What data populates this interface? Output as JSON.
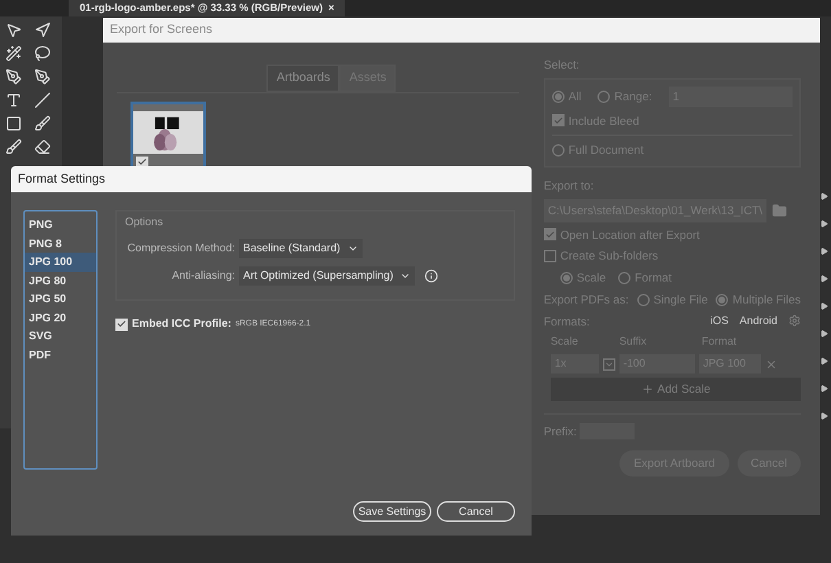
{
  "document_tab": {
    "title": "01-rgb-logo-amber.eps* @ 33.33 % (RGB/Preview)",
    "close": "×"
  },
  "export_dialog": {
    "title": "Export for Screens",
    "tabs": [
      {
        "label": "Artboards",
        "selected": true
      },
      {
        "label": "Assets",
        "selected": false
      }
    ],
    "artboard": {
      "checked": true
    },
    "select": {
      "label": "Select:",
      "options": [
        {
          "label": "All",
          "selected": true
        },
        {
          "label": "Range:",
          "selected": false
        }
      ],
      "range_value": "1",
      "include_bleed": {
        "label": "Include Bleed",
        "checked": true
      },
      "full_document": {
        "label": "Full Document",
        "selected": false
      }
    },
    "export_to": {
      "label": "Export to:",
      "path": "C:\\Users\\stefa\\Desktop\\01_Werk\\13_ICT\\",
      "open_location": {
        "label": "Open Location after Export",
        "checked": true
      },
      "sub_folders": {
        "label": "Create Sub-folders",
        "checked": false
      },
      "sub_options": [
        {
          "label": "Scale",
          "selected": true
        },
        {
          "label": "Format",
          "selected": false
        }
      ]
    },
    "export_pdfs": {
      "label": "Export PDFs as:",
      "options": [
        {
          "label": "Single File",
          "selected": false
        },
        {
          "label": "Multiple Files",
          "selected": true
        }
      ]
    },
    "formats": {
      "label": "Formats:",
      "presets": [
        "iOS",
        "Android"
      ],
      "columns": [
        "Scale",
        "Suffix",
        "Format"
      ],
      "rows": [
        {
          "scale": "1x",
          "suffix": "-100",
          "format": "JPG 100"
        }
      ],
      "add_scale": "Add Scale"
    },
    "prefix": {
      "label": "Prefix:"
    },
    "buttons": [
      "Export Artboard",
      "Cancel"
    ]
  },
  "format_settings": {
    "title": "Format Settings",
    "formats": [
      {
        "label": "PNG",
        "selected": false
      },
      {
        "label": "PNG 8",
        "selected": false
      },
      {
        "label": "JPG 100",
        "selected": true
      },
      {
        "label": "JPG 80",
        "selected": false
      },
      {
        "label": "JPG 50",
        "selected": false
      },
      {
        "label": "JPG 20",
        "selected": false
      },
      {
        "label": "SVG",
        "selected": false
      },
      {
        "label": "PDF",
        "selected": false
      }
    ],
    "options_title": "Options",
    "compression": {
      "label": "Compression Method:",
      "value": "Baseline (Standard)"
    },
    "anti_aliasing": {
      "label": "Anti-aliasing:",
      "value": "Art Optimized (Supersampling)"
    },
    "embed_icc": {
      "label": "Embed ICC Profile:",
      "value": "sRGB IEC61966-2.1",
      "checked": true
    },
    "buttons": [
      "Save Settings",
      "Cancel"
    ]
  }
}
